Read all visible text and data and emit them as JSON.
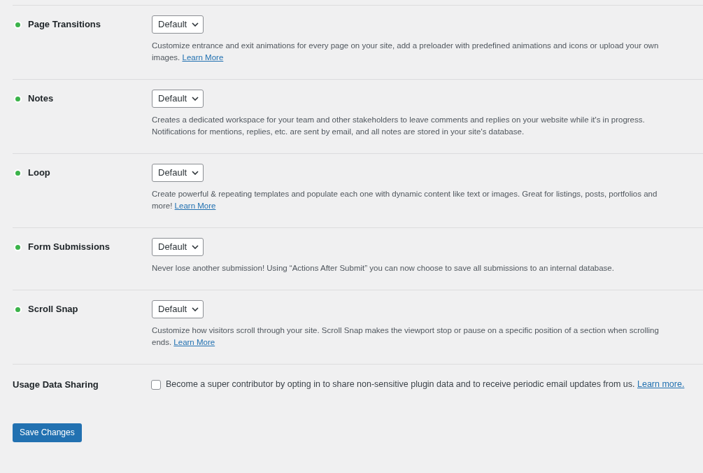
{
  "features": [
    {
      "name": "Page Transitions",
      "active": true,
      "select": "Default",
      "description": "Customize entrance and exit animations for every page on your site, add a preloader with predefined animations and icons or upload your own images.",
      "link": "Learn More"
    },
    {
      "name": "Notes",
      "active": true,
      "select": "Default",
      "description": "Creates a dedicated workspace for your team and other stakeholders to leave comments and replies on your website while it's in progress. Notifications for mentions, replies, etc. are sent by email, and all notes are stored in your site's database."
    },
    {
      "name": "Loop",
      "active": true,
      "select": "Default",
      "description": "Create powerful & repeating templates and populate each one with dynamic content like text or images. Great for listings, posts, portfolios and more!",
      "link": "Learn More"
    },
    {
      "name": "Form Submissions",
      "active": true,
      "select": "Default",
      "description": "Never lose another submission! Using “Actions After Submit” you can now choose to save all submissions to an internal database."
    },
    {
      "name": "Scroll Snap",
      "active": true,
      "select": "Default",
      "description": "Customize how visitors scroll through your site. Scroll Snap makes the viewport stop or pause on a specific position of a section when scrolling ends.",
      "link": "Learn More"
    }
  ],
  "usage_data_sharing": {
    "label": "Usage Data Sharing",
    "checked": false,
    "text": "Become a super contributor by opting in to share non-sensitive plugin data and to receive periodic email updates from us.",
    "link": "Learn more."
  },
  "save_button": "Save Changes"
}
